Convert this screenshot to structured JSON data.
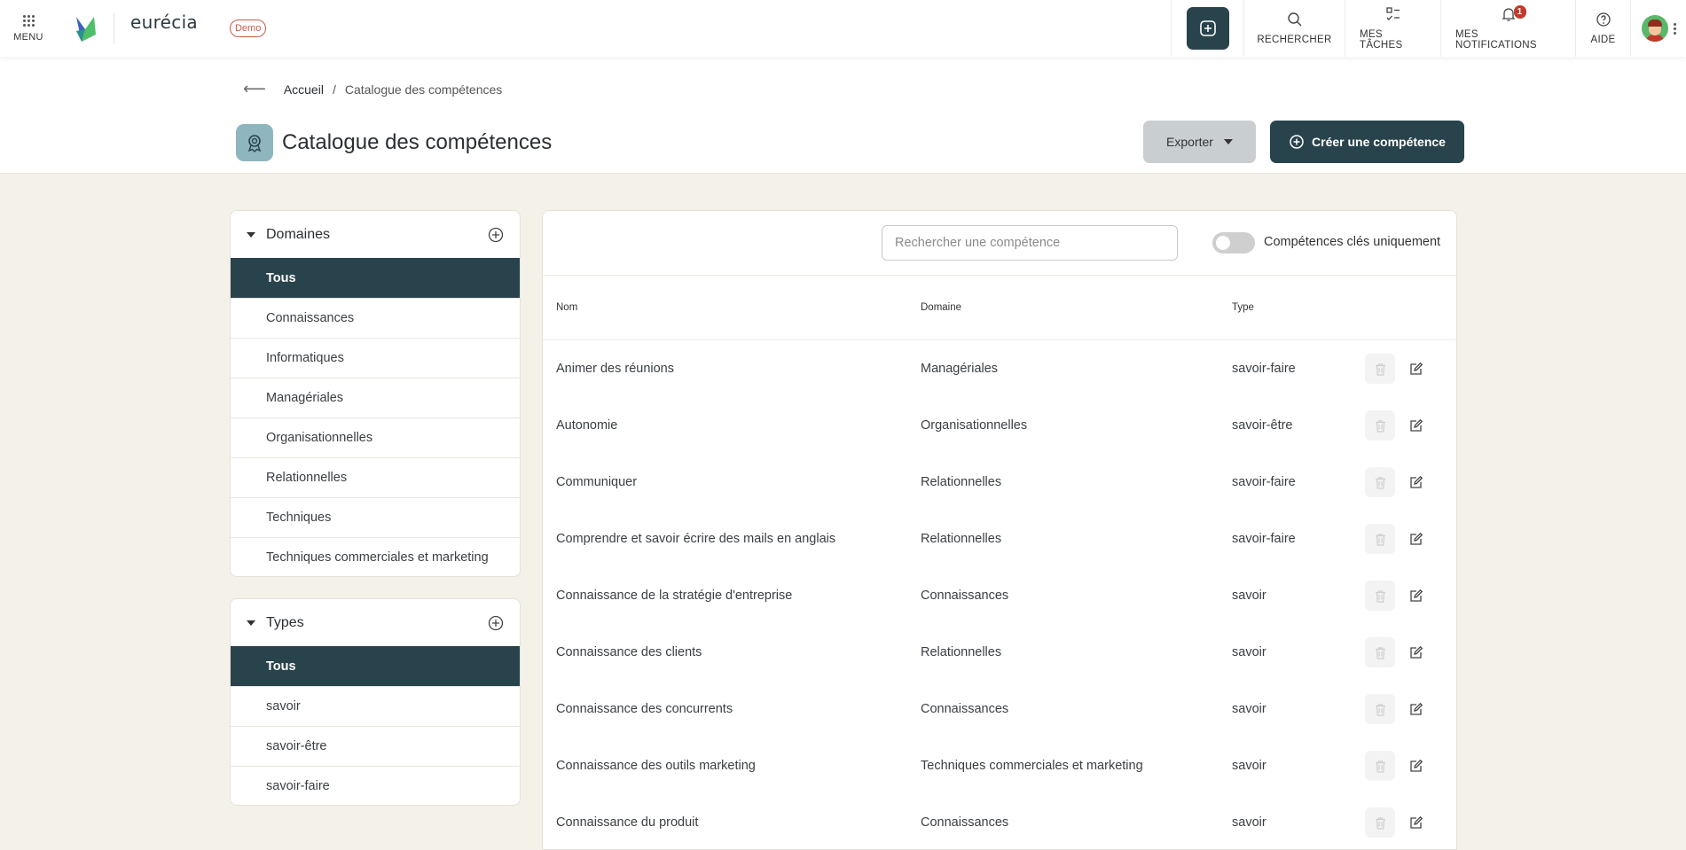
{
  "topbar": {
    "menu_label": "MENU",
    "brand": "eurécia",
    "demo_badge": "Demo",
    "search_label": "RECHERCHER",
    "tasks_label": "MES TÂCHES",
    "notifications_label": "MES NOTIFICATIONS",
    "notifications_count": "1",
    "help_label": "AIDE"
  },
  "breadcrumb": {
    "home": "Accueil",
    "separator": "/",
    "current": "Catalogue des compétences"
  },
  "page": {
    "title": "Catalogue des compétences",
    "export_label": "Exporter",
    "create_label": "Créer une compétence"
  },
  "domains": {
    "title": "Domaines",
    "items": [
      "Tous",
      "Connaissances",
      "Informatiques",
      "Managériales",
      "Organisationnelles",
      "Relationnelles",
      "Techniques",
      "Techniques commerciales et marketing"
    ],
    "active": "Tous"
  },
  "types": {
    "title": "Types",
    "items": [
      "Tous",
      "savoir",
      "savoir-être",
      "savoir-faire"
    ],
    "active": "Tous"
  },
  "table": {
    "search_placeholder": "Rechercher une compétence",
    "toggle_label": "Compétences clés uniquement",
    "toggle_on": false,
    "columns": {
      "nom": "Nom",
      "domaine": "Domaine",
      "type": "Type"
    },
    "rows": [
      {
        "nom": "Animer des réunions",
        "domaine": "Managériales",
        "type": "savoir-faire"
      },
      {
        "nom": "Autonomie",
        "domaine": "Organisationnelles",
        "type": "savoir-être"
      },
      {
        "nom": "Communiquer",
        "domaine": "Relationnelles",
        "type": "savoir-faire"
      },
      {
        "nom": "Comprendre et savoir écrire des mails en anglais",
        "domaine": "Relationnelles",
        "type": "savoir-faire"
      },
      {
        "nom": "Connaissance de la stratégie d'entreprise",
        "domaine": "Connaissances",
        "type": "savoir"
      },
      {
        "nom": "Connaissance des clients",
        "domaine": "Relationnelles",
        "type": "savoir"
      },
      {
        "nom": "Connaissance des concurrents",
        "domaine": "Connaissances",
        "type": "savoir"
      },
      {
        "nom": "Connaissance des outils marketing",
        "domaine": "Techniques commerciales et marketing",
        "type": "savoir"
      },
      {
        "nom": "Connaissance du produit",
        "domaine": "Connaissances",
        "type": "savoir"
      }
    ]
  },
  "colors": {
    "primary": "#28434b",
    "accent": "#c85a48",
    "background": "#f4f1e9",
    "notification": "#c0392b"
  },
  "icons": [
    "menu-grid-icon",
    "plus-circle-icon",
    "search-icon",
    "tasks-icon",
    "bell-icon",
    "help-icon",
    "back-arrow-icon",
    "badge-award-icon",
    "trash-icon",
    "edit-icon",
    "caret-down-icon"
  ]
}
